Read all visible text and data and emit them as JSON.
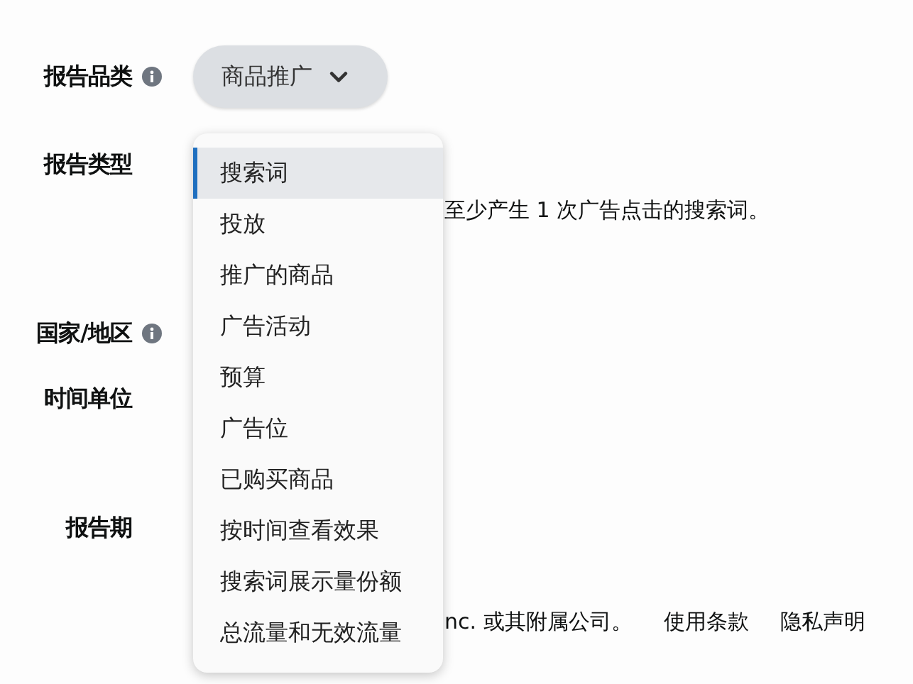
{
  "form": {
    "fields": [
      {
        "label": "报告品类",
        "info": true,
        "kind": "dropdown",
        "value": "商品推广"
      },
      {
        "label": "报告类型",
        "info": false,
        "kind": "text",
        "text": "至少产生 1 次广告点击的搜索词。"
      },
      {
        "label": "国家/地区",
        "info": true,
        "kind": "empty"
      },
      {
        "label": "时间单位",
        "info": false,
        "kind": "empty"
      },
      {
        "label": "报告期",
        "info": false,
        "kind": "empty"
      }
    ]
  },
  "menu": {
    "items": [
      {
        "label": "搜索词",
        "selected": true
      },
      {
        "label": "投放",
        "selected": false
      },
      {
        "label": "推广的商品",
        "selected": false
      },
      {
        "label": "广告活动",
        "selected": false
      },
      {
        "label": "预算",
        "selected": false
      },
      {
        "label": "广告位",
        "selected": false
      },
      {
        "label": "已购买商品",
        "selected": false
      },
      {
        "label": "按时间查看效果",
        "selected": false
      },
      {
        "label": "搜索词展示量份额",
        "selected": false
      },
      {
        "label": "总流量和无效流量",
        "selected": false
      }
    ]
  },
  "footer": {
    "copyright": "nc. 或其附属公司。",
    "links": [
      "使用条款",
      "隐私声明"
    ]
  }
}
